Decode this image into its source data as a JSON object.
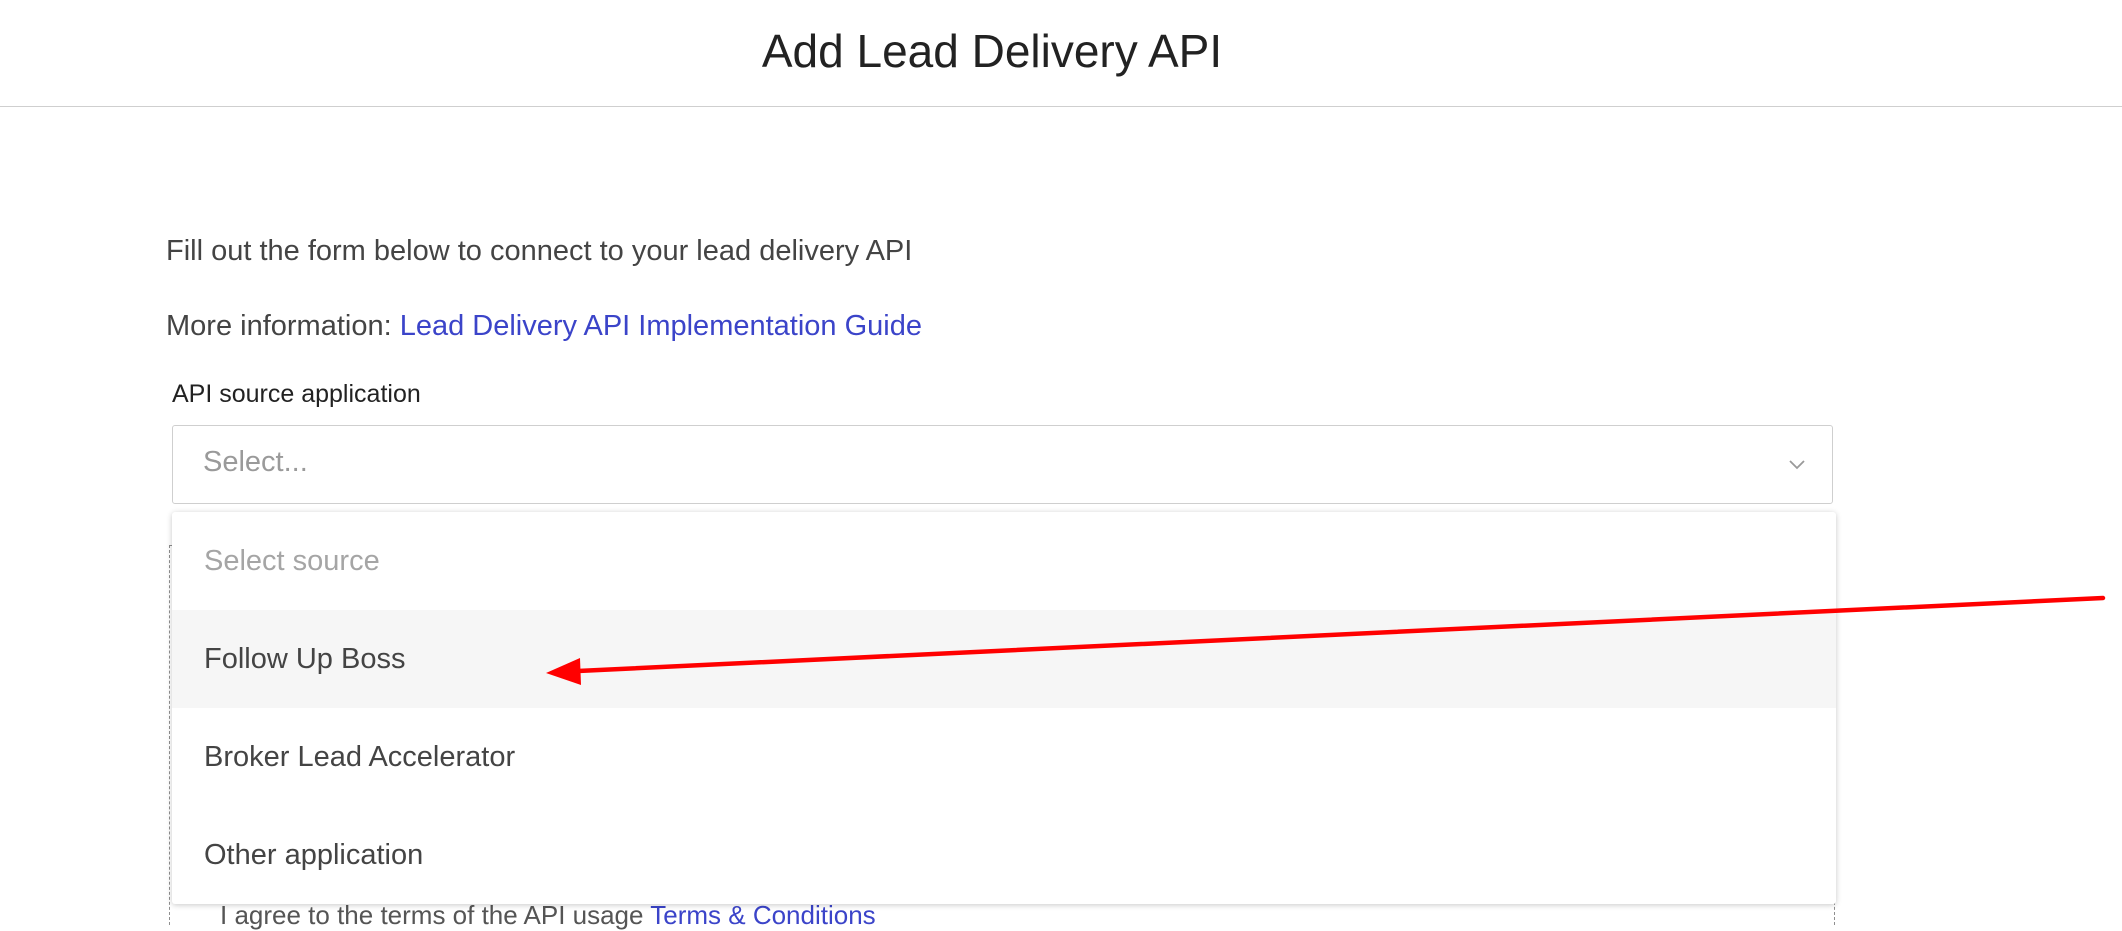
{
  "header": {
    "title": "Add Lead Delivery API"
  },
  "form": {
    "intro": "Fill out the form below to connect to your lead delivery API",
    "more_info_prefix": "More information: ",
    "more_info_link": "Lead Delivery API Implementation Guide",
    "source_label": "API source application",
    "source_placeholder": "Select...",
    "dropdown_icon": "chevron-down-icon",
    "underlying_text_fragment": "I agree to the terms of the API usage",
    "underlying_link_fragment": "Terms & Conditions"
  },
  "dropdown": {
    "options": [
      {
        "label": "Select source",
        "placeholder": true
      },
      {
        "label": "Follow Up Boss",
        "placeholder": false,
        "hovered": true
      },
      {
        "label": "Broker Lead Accelerator",
        "placeholder": false
      },
      {
        "label": "Other application",
        "placeholder": false
      }
    ]
  },
  "annotation": {
    "arrow_color": "#ff0000",
    "points_to": "Follow Up Boss"
  },
  "colors": {
    "link": "#3b44c9",
    "hover_bg": "#f6f6f6",
    "border": "#cfcfcf"
  }
}
